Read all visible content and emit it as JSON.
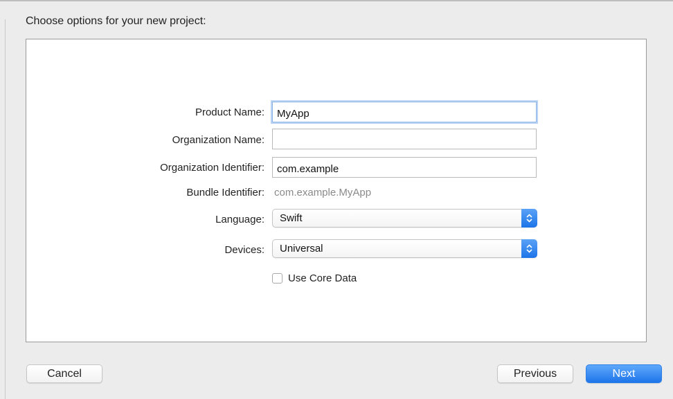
{
  "header": {
    "title": "Choose options for your new project:"
  },
  "form": {
    "product_name": {
      "label": "Product Name:",
      "value": "MyApp"
    },
    "organization_name": {
      "label": "Organization Name:",
      "value": ""
    },
    "organization_identifier": {
      "label": "Organization Identifier:",
      "value": "com.example"
    },
    "bundle_identifier": {
      "label": "Bundle Identifier:",
      "value": "com.example.MyApp"
    },
    "language": {
      "label": "Language:",
      "value": "Swift"
    },
    "devices": {
      "label": "Devices:",
      "value": "Universal"
    },
    "use_core_data": {
      "label": "Use Core Data",
      "checked": false
    }
  },
  "footer": {
    "cancel_label": "Cancel",
    "previous_label": "Previous",
    "next_label": "Next"
  },
  "colors": {
    "accent": "#1e75ea",
    "focus_ring": "#b8d3f3",
    "window_bg": "#ececec"
  }
}
